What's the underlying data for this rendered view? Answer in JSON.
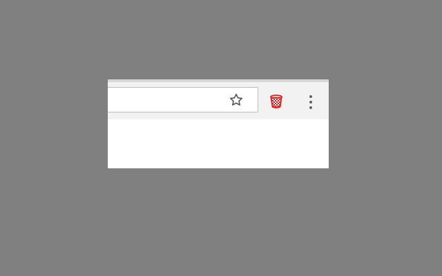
{
  "browser": {
    "address_bar": {
      "value": "",
      "placeholder": ""
    },
    "icons": {
      "bookmark": "star-outline-icon",
      "extension": "trash-can-icon",
      "menu": "vertical-three-dots-icon"
    },
    "colors": {
      "background": "#808080",
      "toolbar": "#f2f2f2",
      "content": "#ffffff",
      "extension_icon": "#e81818",
      "icon_gray": "#5f6368"
    }
  }
}
